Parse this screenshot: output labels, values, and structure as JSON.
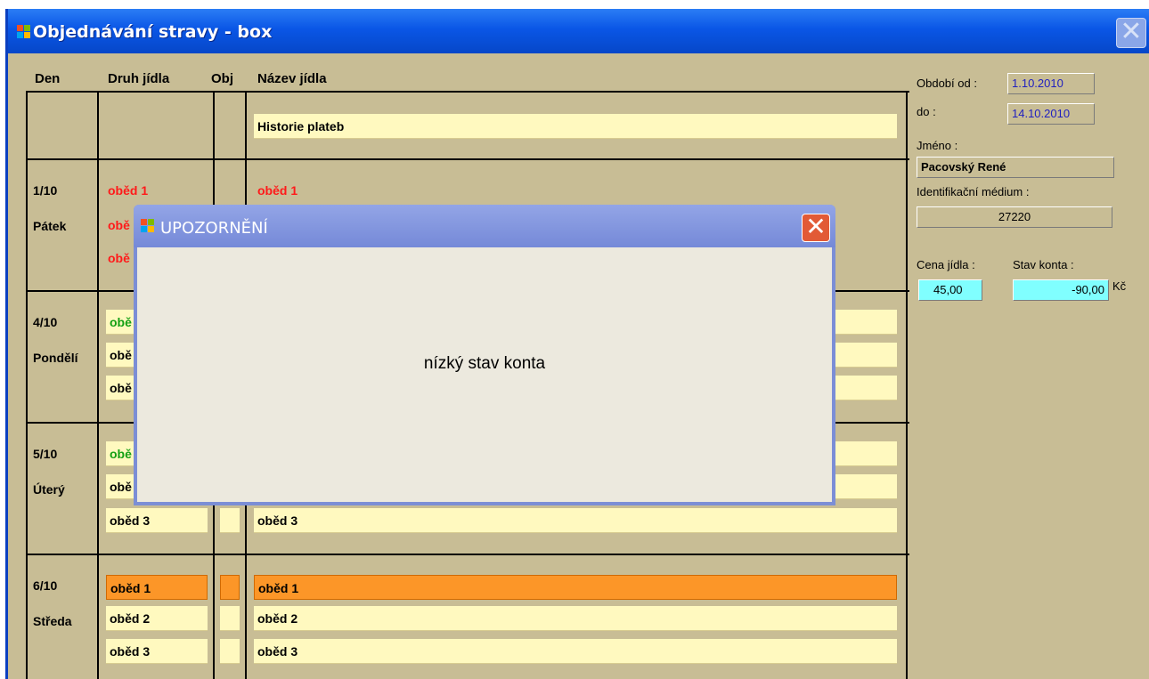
{
  "window": {
    "title": "Objednávání stravy - box",
    "close_label": "✕"
  },
  "table": {
    "headers": {
      "day": "Den",
      "type": "Druh jídla",
      "obj": "Obj",
      "name": "Název jídla"
    },
    "history_label": "Historie plateb",
    "days": [
      {
        "date": "1/10",
        "weekday": "Pátek",
        "meals": [
          "oběd 1",
          "obě",
          "obě"
        ],
        "names": [
          "oběd 1"
        ]
      },
      {
        "date": "4/10",
        "weekday": "Pondělí",
        "meals": [
          "obě",
          "obě",
          "obě"
        ]
      },
      {
        "date": "5/10",
        "weekday": "Úterý",
        "meals": [
          "obě",
          "obě",
          "oběd 3"
        ],
        "names": [
          "oběd 3"
        ]
      },
      {
        "date": "6/10",
        "weekday": "Středa",
        "meals": [
          "oběd 1",
          "oběd 2",
          "oběd 3"
        ],
        "names": [
          "oběd 1",
          "oběd 2",
          "oběd 3"
        ]
      }
    ]
  },
  "side": {
    "period_from_label": "Období od :",
    "period_from": "1.10.2010",
    "period_to_label": "do :",
    "period_to": "14.10.2010",
    "name_label": "Jméno :",
    "name": "Pacovský René",
    "id_label": "Identifikační médium :",
    "id_value": "27220",
    "price_label": "Cena jídla :",
    "price": "45,00",
    "balance_label": "Stav konta :",
    "balance": "-90,00",
    "currency": "Kč"
  },
  "dialog": {
    "title": "UPOZORNĚNÍ",
    "message": "nízký stav konta",
    "close_label": "✕"
  },
  "colors": {
    "titlebar": "#0a56e6",
    "background": "#c8bd95",
    "cell": "#fff9bf",
    "selected": "#fc9628",
    "red_text": "#ff1a1a",
    "green_text": "#14a014",
    "balance_box": "#80ffff"
  }
}
